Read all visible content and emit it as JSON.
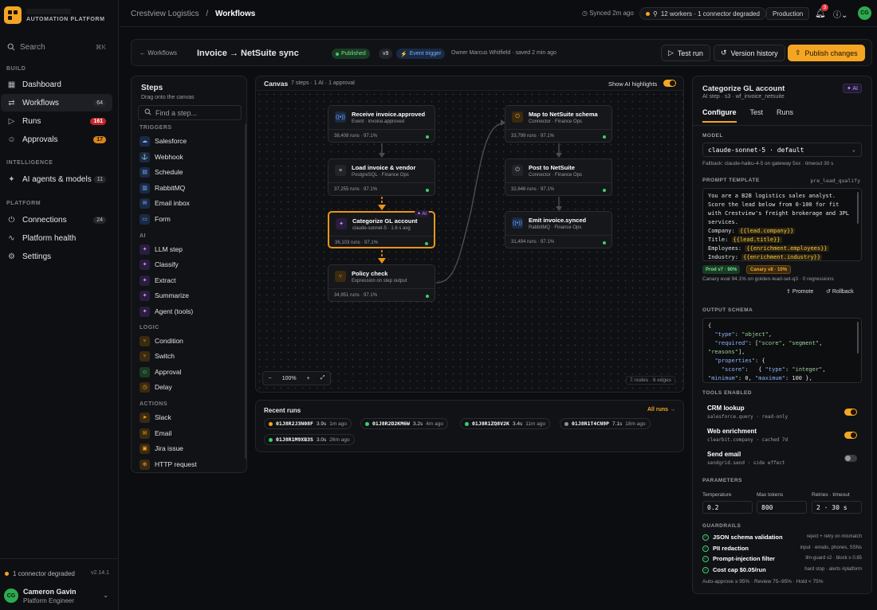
{
  "colors": {
    "accent": "#f5a524",
    "ok": "#3bcf6b",
    "danger": "#e03a3f",
    "ai": "#c89bff"
  },
  "sidebar": {
    "brand_sub": "AUTOMATION PLATFORM",
    "search_placeholder": "Search",
    "search_kbd": "⌘K",
    "sections": {
      "build": "BUILD",
      "intelligence": "INTELLIGENCE",
      "platform": "PLATFORM"
    },
    "items": [
      {
        "label": "Dashboard",
        "icon": "grid-icon"
      },
      {
        "label": "Workflows",
        "icon": "workflow-icon",
        "count": "64",
        "active": true
      },
      {
        "label": "Runs",
        "icon": "play-icon",
        "count": "161"
      },
      {
        "label": "Approvals",
        "icon": "user-check-icon",
        "count": "17"
      },
      {
        "label": "AI agents & models",
        "icon": "sparkle-icon",
        "count": "11"
      },
      {
        "label": "Connections",
        "icon": "plug-icon",
        "count": "24"
      },
      {
        "label": "Platform health",
        "icon": "pulse-icon"
      },
      {
        "label": "Settings",
        "icon": "gear-icon"
      }
    ],
    "status": "1 connector degraded",
    "version": "v2.14.1",
    "user": {
      "initials": "CG",
      "name": "Cameron Gavin",
      "role": "Platform Engineer"
    }
  },
  "header": {
    "org": "Crestview Logistics",
    "sep": "/",
    "page": "Workflows",
    "sync": "Synced 2m ago",
    "workers": "12 workers · 1 connector degraded",
    "env": "Production",
    "notif_count": "3",
    "avatar": "CG"
  },
  "workflow": {
    "back": "Workflows",
    "title": "Invoice → NetSuite sync",
    "status": "Published",
    "version": "v9",
    "trigger": "Event trigger",
    "owner": "Owner Marcus Whitfield · saved 2 min ago",
    "btn_test": "Test run",
    "btn_history": "Version history",
    "btn_publish": "Publish changes"
  },
  "steps_panel": {
    "title": "Steps",
    "subtitle": "Drag onto the canvas",
    "find_placeholder": "Find a step...",
    "categories": {
      "triggers": "TRIGGERS",
      "ai": "AI",
      "logic": "LOGIC",
      "actions": "ACTIONS"
    },
    "triggers": [
      "Salesforce",
      "Webhook",
      "Schedule",
      "RabbitMQ",
      "Email inbox",
      "Form"
    ],
    "ai": [
      "LLM step",
      "Classify",
      "Extract",
      "Summarize",
      "Agent (tools)"
    ],
    "logic": [
      "Condition",
      "Switch",
      "Approval",
      "Delay"
    ],
    "actions": [
      "Slack",
      "Email",
      "Jira issue",
      "HTTP request"
    ]
  },
  "canvas": {
    "title": "Canvas",
    "subtitle": "7 steps · 1 AI · 1 approval",
    "ai_highlights": "Show AI highlights",
    "zoom": "100%",
    "summary": "7 nodes · 6 edges",
    "nodes": [
      {
        "title": "Receive invoice.approved",
        "sub": "Event · invoice.approved",
        "stats": "38,408 runs · 97.1%"
      },
      {
        "title": "Load invoice & vendor",
        "sub": "PostgreSQL · Finance Ops",
        "stats": "37,255 runs · 97.1%"
      },
      {
        "title": "Categorize GL account",
        "sub": "claude-sonnet-5 · 1.6 s avg",
        "stats": "36,103 runs · 97.1%",
        "badge": "AI"
      },
      {
        "title": "Policy check",
        "sub": "Expression on step output",
        "stats": "34,951 runs · 97.1%"
      },
      {
        "title": "Map to NetSuite schema",
        "sub": "Connector · Finance Ops",
        "stats": "33,799 runs · 97.1%"
      },
      {
        "title": "Post to NetSuite",
        "sub": "Connector · Finance Ops",
        "stats": "32,646 runs · 97.1%"
      },
      {
        "title": "Emit invoice.synced",
        "sub": "RabbitMQ · Finance Ops",
        "stats": "31,494 runs · 97.1%"
      }
    ]
  },
  "recent_runs": {
    "title": "Recent runs",
    "all": "All runs →",
    "items": [
      {
        "id": "01J8R2J3N08F",
        "dur": "3.9s",
        "ago": "1m ago",
        "status": "#f5a524"
      },
      {
        "id": "01J8R2D2KM6W",
        "dur": "3.2s",
        "ago": "4m ago",
        "status": "#3bcf6b"
      },
      {
        "id": "01J8R1ZQ8V2K",
        "dur": "3.4s",
        "ago": "11m ago",
        "status": "#3bcf6b"
      },
      {
        "id": "01J8R1T4CN9P",
        "dur": "7.1s",
        "ago": "18m ago",
        "status": "#8e9199"
      },
      {
        "id": "01J8R1M9XB3S",
        "dur": "3.0s",
        "ago": "26m ago",
        "status": "#3bcf6b"
      }
    ]
  },
  "inspector": {
    "title": "Categorize GL account",
    "badge": "AI",
    "sub": "AI step · s3 · wf_invoice_netsuite",
    "tabs": [
      "Configure",
      "Test",
      "Runs"
    ],
    "model_label": "MODEL",
    "model": "claude-sonnet-5 · default",
    "fallback": "Fallback: claude-haiku-4-5 on gateway 5xx · timeout 30 s",
    "prompt_label": "PROMPT TEMPLATE",
    "prompt_id": "pre_lead_qualify",
    "prompt_lines": [
      "You are a B2B logistics sales analyst.",
      "Score the lead below from 0-100 for fit",
      "with Crestview's freight brokerage and 3PL",
      "services."
    ],
    "prompt_vars": [
      {
        "k": "Company:",
        "v": "{{lead.company}}"
      },
      {
        "k": "Title:",
        "v": "{{lead.title}}"
      },
      {
        "k": "Employees:",
        "v": "{{enrichment.employees}}"
      },
      {
        "k": "Industry:",
        "v": "{{enrichment.industry}}"
      }
    ],
    "prod_tag": "Prod v7 · 90%",
    "canary_tag": "Canary v8 · 10%",
    "canary_note": "Canary eval 94.1% on golden-lead-set-q3 · 0 regressions",
    "promote": "Promote",
    "rollback": "Rollback",
    "schema_label": "OUTPUT SCHEMA",
    "tools_label": "TOOLS ENABLED",
    "tools": [
      {
        "name": "CRM lookup",
        "desc": "salesforce.query · read-only",
        "on": true
      },
      {
        "name": "Web enrichment",
        "desc": "clearbit.company · cached 7d",
        "on": true
      },
      {
        "name": "Send email",
        "desc": "sendgrid.send · side effect",
        "on": false
      }
    ],
    "params_label": "PARAMETERS",
    "params": [
      {
        "label": "Temperature",
        "value": "0.2"
      },
      {
        "label": "Max tokens",
        "value": "800"
      },
      {
        "label": "Retries · timeout",
        "value": "2 · 30 s"
      }
    ],
    "guard_label": "GUARDRAILS",
    "guardrails": [
      {
        "name": "JSON schema validation",
        "desc": "reject + retry on mismatch"
      },
      {
        "name": "PII redaction",
        "desc": "input · emails, phones, SSNs"
      },
      {
        "name": "Prompt-injection filter",
        "desc": "llm-guard v2 · block ≥ 0.85"
      },
      {
        "name": "Cost cap $0.05/run",
        "desc": "hard stop · alerts #platform"
      }
    ],
    "footer": "Auto-approve ≥ 95% · Review 75–95% · Hold < 75%"
  }
}
